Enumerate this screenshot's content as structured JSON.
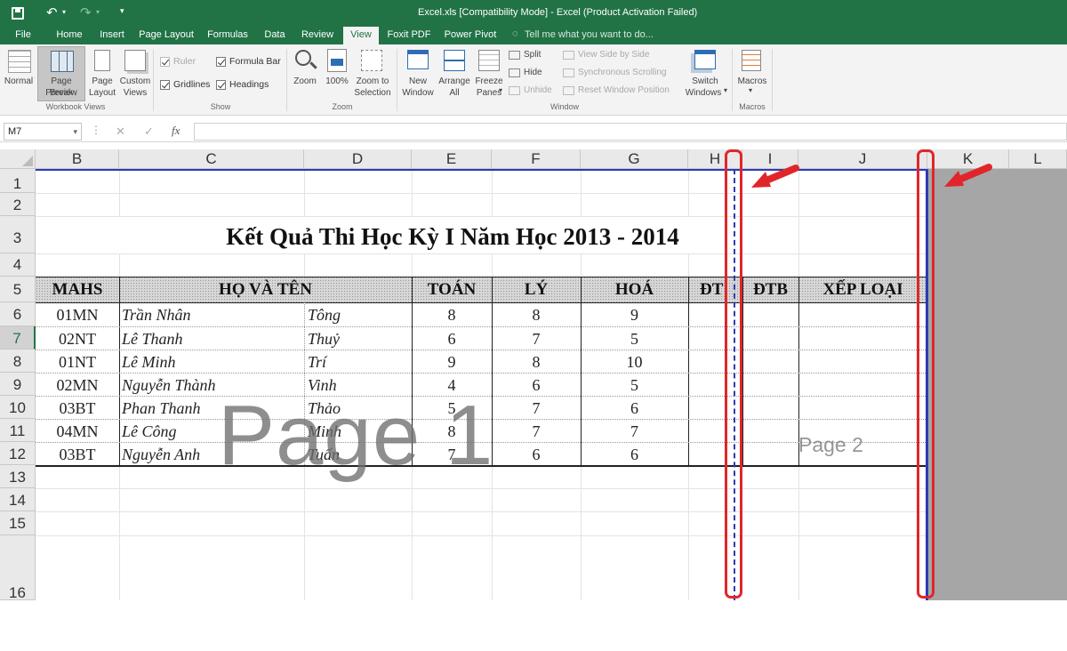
{
  "window": {
    "title": "Excel.xls  [Compatibility Mode] - Excel (Product Activation Failed)"
  },
  "quick_access": {
    "save_icon": "save-icon",
    "undo_icon": "undo-icon",
    "redo_icon": "redo-icon",
    "customize_icon": "customize-icon"
  },
  "tabs": [
    "File",
    "Home",
    "Insert",
    "Page Layout",
    "Formulas",
    "Data",
    "Review",
    "View",
    "Foxit PDF",
    "Power Pivot"
  ],
  "active_tab": "View",
  "tell_me": "Tell me what you want to do...",
  "ribbon": {
    "workbook_views": {
      "group": "Workbook Views",
      "normal": "Normal",
      "page_break_1": "Page Break",
      "page_break_2": "Preview",
      "page_layout_1": "Page",
      "page_layout_2": "Layout",
      "custom_1": "Custom",
      "custom_2": "Views"
    },
    "show": {
      "group": "Show",
      "ruler": "Ruler",
      "formula_bar": "Formula Bar",
      "gridlines": "Gridlines",
      "headings": "Headings"
    },
    "zoom": {
      "group": "Zoom",
      "zoom": "Zoom",
      "hundred": "100%",
      "sel_1": "Zoom to",
      "sel_2": "Selection"
    },
    "window": {
      "group": "Window",
      "new_1": "New",
      "new_2": "Window",
      "arrange_1": "Arrange",
      "arrange_2": "All",
      "freeze_1": "Freeze",
      "freeze_2": "Panes",
      "split": "Split",
      "hide": "Hide",
      "unhide": "Unhide",
      "side": "View Side by Side",
      "sync": "Synchronous Scrolling",
      "reset": "Reset Window Position",
      "switch_1": "Switch",
      "switch_2": "Windows"
    },
    "macros": {
      "group": "Macros",
      "macros": "Macros"
    }
  },
  "formula_bar": {
    "name_box": "M7",
    "fx": "fx",
    "cancel": "✕",
    "enter": "✓",
    "value": ""
  },
  "columns": [
    "B",
    "C",
    "D",
    "E",
    "F",
    "G",
    "H",
    "I",
    "J",
    "K",
    "L"
  ],
  "rows": [
    "1",
    "2",
    "3",
    "4",
    "5",
    "6",
    "7",
    "8",
    "9",
    "10",
    "11",
    "12",
    "13",
    "14",
    "15",
    "16"
  ],
  "sheet": {
    "title": "Kết Quả Thi Học Kỳ I Năm Học 2013 - 2014",
    "headers": {
      "mahs": "MAHS",
      "name": "HỌ VÀ TÊN",
      "toan": "TOÁN",
      "ly": "LÝ",
      "hoa": "HOÁ",
      "dt": "ĐT",
      "dtb": "ĐTB",
      "xeploai": "XẾP LOẠI"
    },
    "records": [
      {
        "mahs": "01MN",
        "ho": "Trần Nhân",
        "ten": "Tông",
        "toan": "8",
        "ly": "8",
        "hoa": "9"
      },
      {
        "mahs": "02NT",
        "ho": "Lê Thanh",
        "ten": "Thuỷ",
        "toan": "6",
        "ly": "7",
        "hoa": "5"
      },
      {
        "mahs": "01NT",
        "ho": "Lê Minh",
        "ten": "Trí",
        "toan": "9",
        "ly": "8",
        "hoa": "10"
      },
      {
        "mahs": "02MN",
        "ho": "Nguyễn Thành",
        "ten": "Vinh",
        "toan": "4",
        "ly": "6",
        "hoa": "5"
      },
      {
        "mahs": "03BT",
        "ho": "Phan Thanh",
        "ten": "Thảo",
        "toan": "5",
        "ly": "7",
        "hoa": "6"
      },
      {
        "mahs": "04MN",
        "ho": "Lê Công",
        "ten": "Minh",
        "toan": "8",
        "ly": "7",
        "hoa": "7"
      },
      {
        "mahs": "03BT",
        "ho": "Nguyễn Anh",
        "ten": "Tuấn",
        "toan": "7",
        "ly": "6",
        "hoa": "6"
      }
    ],
    "page1": "Page 1",
    "page2": "Page 2"
  },
  "colors": {
    "excel_green": "#217346",
    "page_break_blue": "#2c3bb5",
    "annotation_red": "#e0262b",
    "outside_print_area": "#a6a6a6"
  }
}
